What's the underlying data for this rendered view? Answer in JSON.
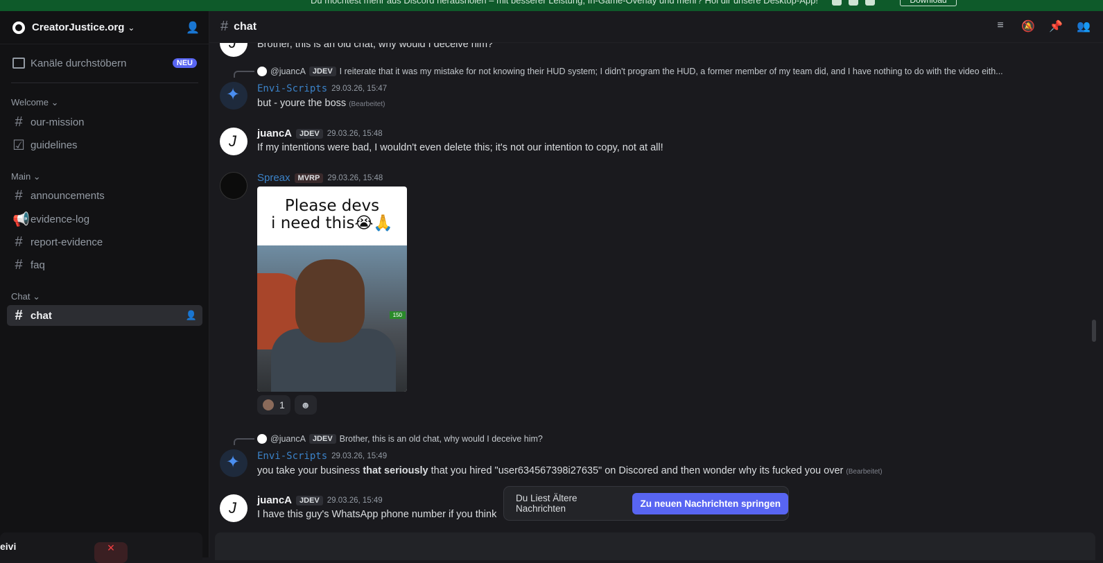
{
  "banner": {
    "text": "Du möchtest mehr aus Discord herausholen – mit besserer Leistung, In-Game-Overlay und mehr? Hol dir unsere Desktop-App!",
    "download": "Download"
  },
  "server": {
    "name": "CreatorJustice.org",
    "browse_label": "Kanäle durchstöbern",
    "browse_badge": "NEU"
  },
  "sidebar": {
    "categories": [
      {
        "label": "Welcome",
        "channels": [
          {
            "label": "our-mission"
          },
          {
            "label": "guidelines"
          }
        ]
      },
      {
        "label": "Main",
        "channels": [
          {
            "label": "announcements"
          },
          {
            "label": "evidence-log"
          },
          {
            "label": "report-evidence"
          },
          {
            "label": "faq"
          }
        ]
      },
      {
        "label": "Chat",
        "channels": [
          {
            "label": "chat"
          }
        ]
      }
    ]
  },
  "user": {
    "name": "eivi"
  },
  "channel": {
    "title": "chat"
  },
  "messages": {
    "top_cut": "Brother, this is an old chat, why would I deceive him?",
    "m1": {
      "reply_user": "@juancA",
      "reply_tag": "JDEV",
      "reply_text": "I reiterate that it was my mistake for not knowing their HUD system; I didn't program the HUD, a former member of my team did, and I have nothing to do with the video eith...",
      "user": "Envi-Scripts",
      "time": "29.03.26, 15:47",
      "text": "but - youre the boss",
      "edited": "(Bearbeitet)"
    },
    "m2": {
      "user": "juancA",
      "tag": "JDEV",
      "time": "29.03.26, 15:48",
      "text": "If my intentions were bad, I wouldn't even delete this; it's not our intention to copy, not at all!"
    },
    "m3": {
      "user": "Spreax",
      "tag": "MVRP",
      "time": "29.03.26, 15:48",
      "embed_caption_1": "Please devs",
      "embed_caption_2": "i need this😭🙏",
      "embed_badge": "150",
      "reaction_count": "1"
    },
    "m4": {
      "reply_user": "@juancA",
      "reply_tag": "JDEV",
      "reply_text": "Brother, this is an old chat, why would I deceive him?",
      "user": "Envi-Scripts",
      "time": "29.03.26, 15:49",
      "text_a": "you take your business ",
      "text_bold": "that seriously",
      "text_b": " that you hired \"user634567398i27635\" on Discored and then wonder why its fucked you over",
      "edited": "(Bearbeitet)"
    },
    "m5": {
      "user": "juancA",
      "tag": "JDEV",
      "time": "29.03.26, 15:49",
      "text": "I have this guy's WhatsApp phone number if you think"
    }
  },
  "jump": {
    "label": "Du Liest Ältere Nachrichten",
    "button": "Zu neuen Nachrichten springen"
  }
}
